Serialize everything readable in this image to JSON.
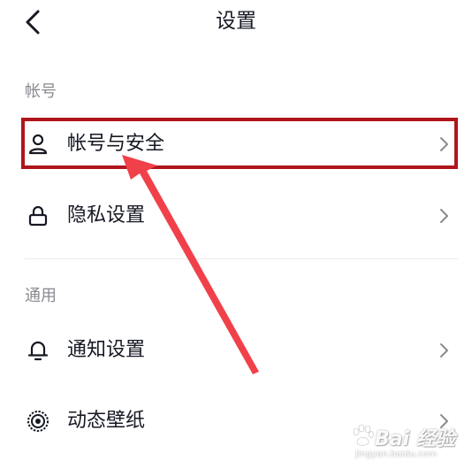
{
  "header": {
    "title": "设置",
    "back_icon": "chevron-left-icon"
  },
  "sections": [
    {
      "title": "帐号",
      "items": [
        {
          "label": "帐号与安全",
          "icon": "user-icon",
          "highlighted": true
        },
        {
          "label": "隐私设置",
          "icon": "lock-icon",
          "highlighted": false
        }
      ]
    },
    {
      "title": "通用",
      "items": [
        {
          "label": "通知设置",
          "icon": "bell-icon",
          "highlighted": false
        },
        {
          "label": "动态壁纸",
          "icon": "wallpaper-icon",
          "highlighted": false
        }
      ]
    }
  ],
  "annotation": {
    "highlight_color": "#b0151b",
    "arrow_color": "#f0414a"
  },
  "watermark": {
    "brand": "Bai 经验",
    "url": "jingyan.baidu.com"
  }
}
